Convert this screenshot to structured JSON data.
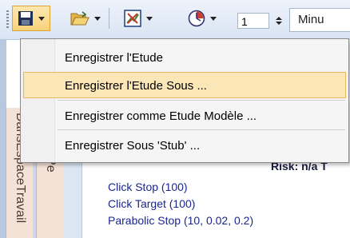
{
  "toolbar": {
    "spin_value": "1",
    "minu_label": "Minu"
  },
  "background": {
    "vertical_tab_1": "DansEspaceTravail",
    "vertical_tab_2": "arre de Pe",
    "risk_label": "Risk: n/a  T",
    "studies": [
      "Click Stop  (100)",
      "Click Target  (100)",
      "Parabolic Stop  (10, 0.02, 0.2)"
    ]
  },
  "menu": {
    "items": [
      {
        "label": "Enregistrer l'Etude"
      },
      {
        "label": "Enregistrer l'Etude Sous ..."
      },
      {
        "label": "Enregistrer comme Etude Modèle ..."
      },
      {
        "label": "Enregistrer Sous 'Stub' ..."
      }
    ],
    "highlighted_index": 1
  },
  "colors": {
    "menu_highlight": "#fbe6b8",
    "menu_highlight_border": "#e8b860",
    "study_text": "#1a2690",
    "toolbar_bg": "#dfe8f5"
  }
}
